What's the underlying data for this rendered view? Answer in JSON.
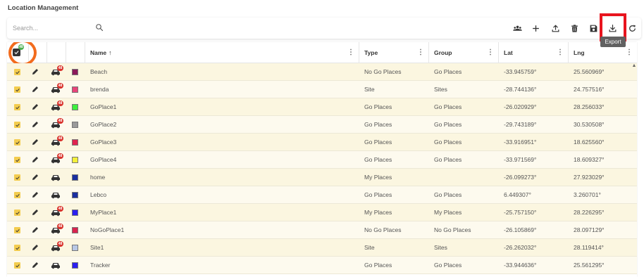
{
  "page": {
    "title": "Location Management"
  },
  "search": {
    "placeholder": "Search..."
  },
  "toolbar": {
    "buttons": [
      {
        "name": "group-icon"
      },
      {
        "name": "add-icon"
      },
      {
        "name": "upload-icon"
      },
      {
        "name": "delete-icon"
      },
      {
        "name": "save-icon"
      },
      {
        "name": "download-icon"
      },
      {
        "name": "refresh-icon"
      }
    ],
    "export_tooltip": "Export"
  },
  "table": {
    "selected_count": "48",
    "headers": {
      "name": "Name",
      "type": "Type",
      "group": "Group",
      "lat": "Lat",
      "lng": "Lng"
    },
    "sort_indicator": "↑",
    "menu_glyph": "⋮",
    "rows": [
      {
        "name": "Beach",
        "type": "No Go Places",
        "group": "Go Places",
        "lat": "-33.945759°",
        "lng": "25.560969°",
        "color": "#8b1a5a",
        "badge": "48"
      },
      {
        "name": "brenda",
        "type": "Site",
        "group": "Sites",
        "lat": "-28.744136°",
        "lng": "24.757516°",
        "color": "#e8457a",
        "badge": "48"
      },
      {
        "name": "GoPlace1",
        "type": "Go Places",
        "group": "Go Places",
        "lat": "-26.020929°",
        "lng": "28.256033°",
        "color": "#3ef03c",
        "badge": "48"
      },
      {
        "name": "GoPlace2",
        "type": "Go Places",
        "group": "Go Places",
        "lat": "-29.743189°",
        "lng": "30.530508°",
        "color": "#9a9a9a",
        "badge": "48"
      },
      {
        "name": "GoPlace3",
        "type": "Go Places",
        "group": "Go Places",
        "lat": "-33.916951°",
        "lng": "18.625560°",
        "color": "#e0234e",
        "badge": "48"
      },
      {
        "name": "GoPlace4",
        "type": "Go Places",
        "group": "Go Places",
        "lat": "-33.971569°",
        "lng": "18.609327°",
        "color": "#f4f03a",
        "badge": "48"
      },
      {
        "name": "home",
        "type": "My Places",
        "group": "",
        "lat": "-26.099273°",
        "lng": "27.923029°",
        "color": "#1a2fa0",
        "badge": ""
      },
      {
        "name": "Lebco",
        "type": "Go Places",
        "group": "Go Places",
        "lat": "6.449307°",
        "lng": "3.260701°",
        "color": "#1a2fa0",
        "badge": ""
      },
      {
        "name": "MyPlace1",
        "type": "My Places",
        "group": "My Places",
        "lat": "-25.757150°",
        "lng": "28.226295°",
        "color": "#2b1ff0",
        "badge": "48"
      },
      {
        "name": "NoGoPlace1",
        "type": "No Go Places",
        "group": "No Go Places",
        "lat": "-26.105869°",
        "lng": "28.097129°",
        "color": "#d9234e",
        "badge": "48"
      },
      {
        "name": "Site1",
        "type": "Site",
        "group": "Sites",
        "lat": "-26.262032°",
        "lng": "28.119414°",
        "color": "#b8c8e6",
        "badge": "48"
      },
      {
        "name": "Tracker",
        "type": "Go Places",
        "group": "Go Places",
        "lat": "-33.944636°",
        "lng": "25.561295°",
        "color": "#2b1ff0",
        "badge": ""
      }
    ]
  }
}
